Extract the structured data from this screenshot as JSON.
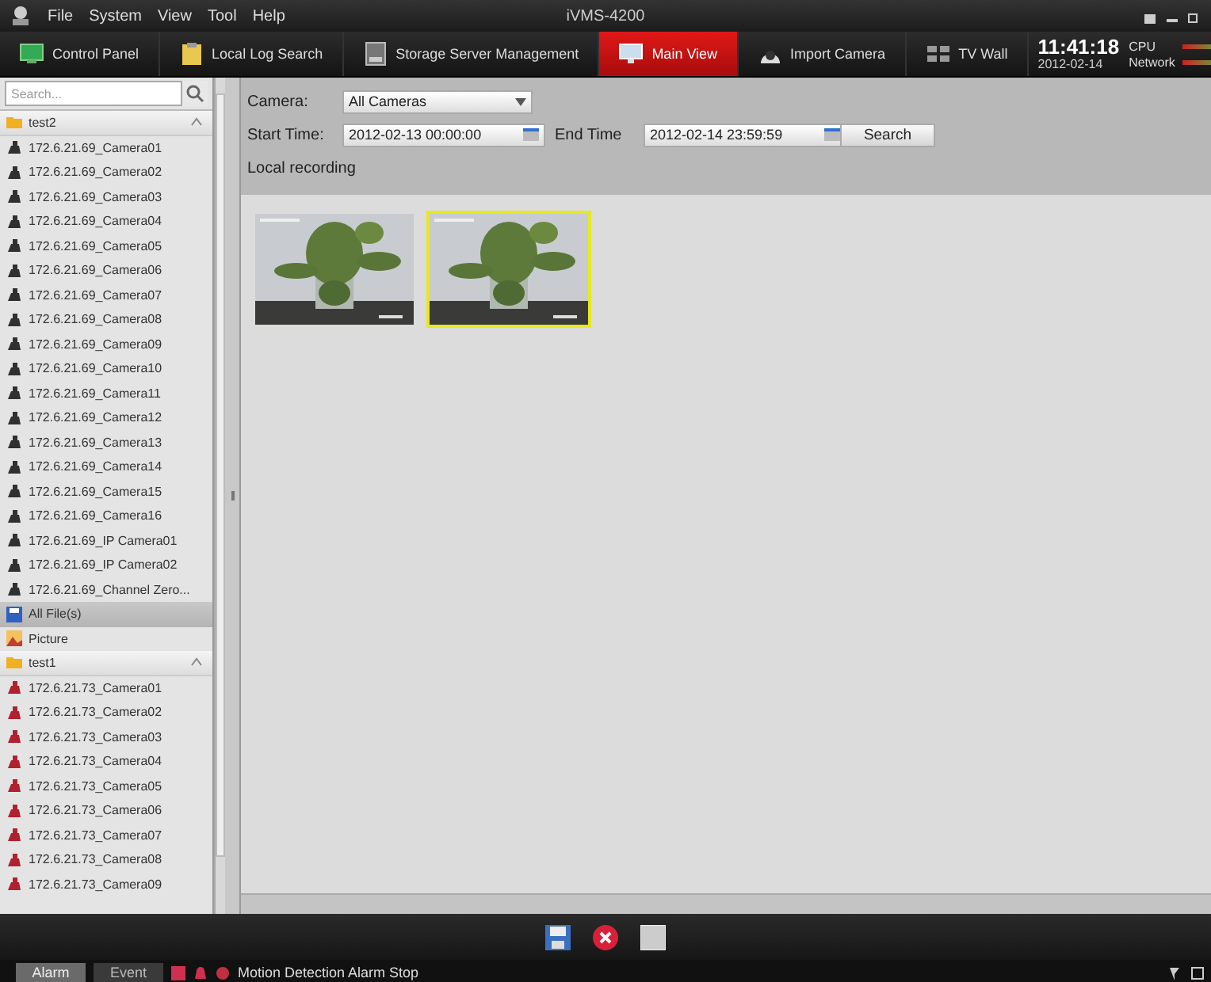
{
  "title_bar": {
    "menu": [
      "File",
      "System",
      "View",
      "Tool",
      "Help"
    ],
    "title": "iVMS-4200"
  },
  "tabs": [
    {
      "label": "Control Panel",
      "kind": "panel",
      "selected": false
    },
    {
      "label": "Local Log Search",
      "kind": "log",
      "selected": false
    },
    {
      "label": "Storage Server Management",
      "kind": "storage",
      "selected": false
    },
    {
      "label": "Main View",
      "kind": "monitor",
      "selected": true
    },
    {
      "label": "Import Camera",
      "kind": "camera",
      "selected": false
    },
    {
      "label": "TV Wall",
      "kind": "tvwall",
      "selected": false
    }
  ],
  "clock": {
    "time": "11:41:18",
    "date": "2012-02-14"
  },
  "meters": [
    {
      "label": "CPU"
    },
    {
      "label": "Network"
    }
  ],
  "sidebar": {
    "search": {
      "placeholder": "Search..."
    },
    "groups": [
      {
        "kind": "folder",
        "label": "test2",
        "expanded": true,
        "color": "#303030",
        "children": [
          {
            "name": "172.6.21.69_Camera01"
          },
          {
            "name": "172.6.21.69_Camera02"
          },
          {
            "name": "172.6.21.69_Camera03"
          },
          {
            "name": "172.6.21.69_Camera04"
          },
          {
            "name": "172.6.21.69_Camera05"
          },
          {
            "name": "172.6.21.69_Camera06"
          },
          {
            "name": "172.6.21.69_Camera07"
          },
          {
            "name": "172.6.21.69_Camera08"
          },
          {
            "name": "172.6.21.69_Camera09"
          },
          {
            "name": "172.6.21.69_Camera10"
          },
          {
            "name": "172.6.21.69_Camera11"
          },
          {
            "name": "172.6.21.69_Camera12"
          },
          {
            "name": "172.6.21.69_Camera13"
          },
          {
            "name": "172.6.21.69_Camera14"
          },
          {
            "name": "172.6.21.69_Camera15"
          },
          {
            "name": "172.6.21.69_Camera16"
          },
          {
            "name": "172.6.21.69_IP Camera01"
          },
          {
            "name": "172.6.21.69_IP Camera02"
          },
          {
            "name": "172.6.21.69_Channel Zero..."
          }
        ]
      },
      {
        "kind": "files",
        "label": "All File(s)",
        "selected": true
      },
      {
        "kind": "picture",
        "label": "Picture",
        "selected": false
      },
      {
        "kind": "folder",
        "label": "test1",
        "expanded": true,
        "color": "#b02030",
        "children": [
          {
            "name": "172.6.21.73_Camera01"
          },
          {
            "name": "172.6.21.73_Camera02"
          },
          {
            "name": "172.6.21.73_Camera03"
          },
          {
            "name": "172.6.21.73_Camera04"
          },
          {
            "name": "172.6.21.73_Camera05"
          },
          {
            "name": "172.6.21.73_Camera06"
          },
          {
            "name": "172.6.21.73_Camera07"
          },
          {
            "name": "172.6.21.73_Camera08"
          },
          {
            "name": "172.6.21.73_Camera09"
          }
        ]
      }
    ]
  },
  "filters": {
    "camera_label": "Camera:",
    "camera_value": "All Cameras",
    "start_label": "Start Time:",
    "start_value": "2012-02-13 00:00:00",
    "end_label": "End Time",
    "end_value": "2012-02-14 23:59:59",
    "search_button": "Search",
    "section": "Local recording"
  },
  "recordings": [
    {
      "kind": "picture",
      "selected": false
    },
    {
      "kind": "picture",
      "selected": true
    }
  ],
  "status_bar": {
    "tabs": [
      {
        "label": "Alarm",
        "selected": true
      },
      {
        "label": "Event",
        "selected": false
      }
    ],
    "message": "Motion Detection Alarm  Stop"
  }
}
